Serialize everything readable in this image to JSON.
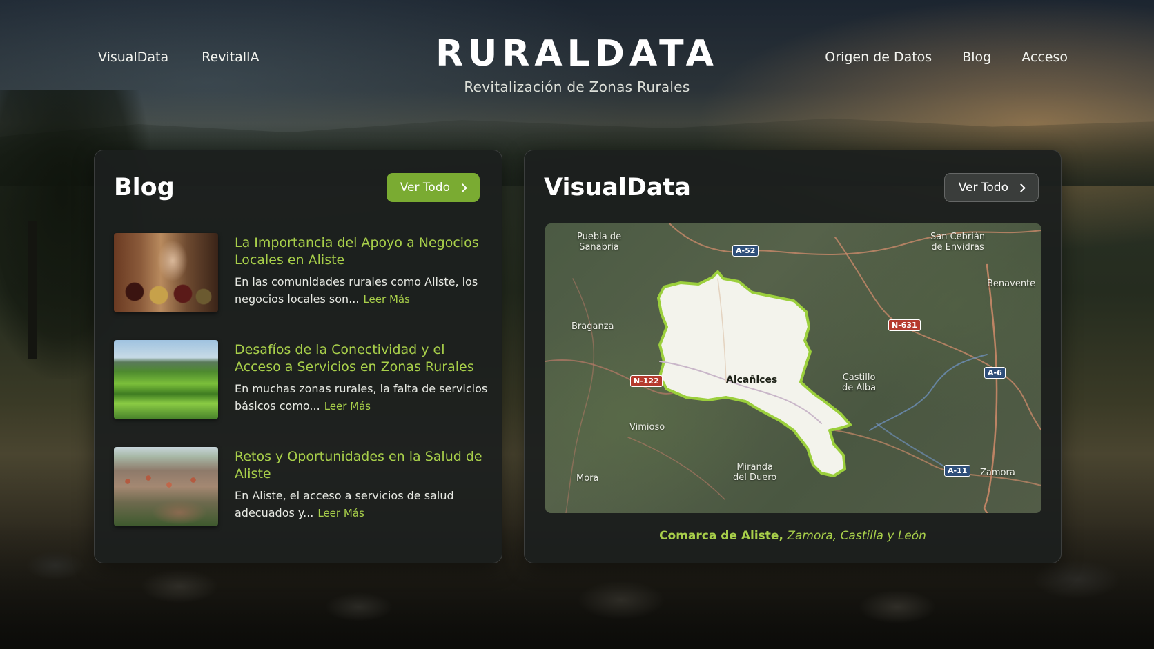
{
  "nav": {
    "left": [
      "VisualData",
      "RevitalIA"
    ],
    "right": [
      "Origen de Datos",
      "Blog",
      "Acceso"
    ]
  },
  "brand": {
    "title": "RURALDATA",
    "subtitle": "Revitalización de Zonas Rurales"
  },
  "blog": {
    "title": "Blog",
    "view_all": "Ver Todo",
    "read_more": "Leer Más",
    "posts": [
      {
        "title": "La Importancia del Apoyo a Negocios Locales en Aliste",
        "excerpt": "En las comunidades rurales como Aliste, los negocios locales son...",
        "image": "local-shop-photo"
      },
      {
        "title": "Desafíos de la Conectividad y el Acceso a Servicios en Zonas Rurales",
        "excerpt": "En muchas zonas rurales, la falta de servicios básicos como...",
        "image": "green-fields-photo"
      },
      {
        "title": "Retos y Oportunidades en la Salud de Aliste",
        "excerpt": "En Aliste, el acceso a servicios de salud adecuados y...",
        "image": "village-aerial-photo"
      }
    ]
  },
  "visualdata": {
    "title": "VisualData",
    "view_all": "Ver Todo",
    "map": {
      "places": {
        "puebla": "Puebla de\nSanabria",
        "sancebrian": "San Cebrián\nde Envidras",
        "benavente": "Benavente",
        "braganza": "Braganza",
        "alcanices": "Alcañices",
        "castillo": "Castillo\nde Alba",
        "vimioso": "Vimioso",
        "mora": "Mora",
        "miranda": "Miranda\ndel Duero",
        "zamora": "Zamora"
      },
      "roads": {
        "a52": "A-52",
        "n631": "N-631",
        "n122": "N-122",
        "a6": "A-6",
        "a11": "A-11"
      },
      "region_fill": "#f3f3ec",
      "region_stroke": "#9bcf3c"
    },
    "caption_bold": "Comarca de Aliste,",
    "caption_rest": " Zamora, Castilla y León"
  },
  "colors": {
    "accent": "#a8cf4a",
    "button_green": "#7aab32"
  }
}
